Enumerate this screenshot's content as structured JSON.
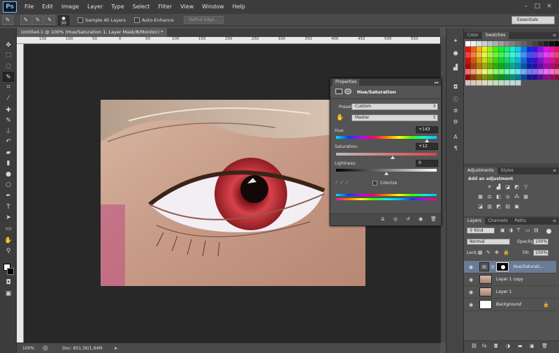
{
  "menubar": {
    "logo": "Ps",
    "items": [
      "File",
      "Edit",
      "Image",
      "Layer",
      "Type",
      "Select",
      "Filter",
      "View",
      "Window",
      "Help"
    ],
    "controls": [
      "–",
      "□",
      "×"
    ]
  },
  "options": {
    "brush_size": "30",
    "sample_all_layers": "Sample All Layers",
    "auto_enhance": "Auto-Enhance",
    "refine_edge": "Refine Edge...",
    "workspace": "Essentials"
  },
  "document": {
    "tab_title": "Untitled-1 @ 100% (Hue/Saturation 1, Layer Mask/8/Monitor) *",
    "zoom": "100%",
    "doc_info": "Doc: 851,3K/1,94M"
  },
  "ruler": {
    "top_ticks": [
      "150",
      "100",
      "50",
      "0",
      "50",
      "100",
      "150",
      "200",
      "250",
      "300",
      "350",
      "400",
      "450",
      "500",
      "550"
    ]
  },
  "properties": {
    "title": "Properties",
    "adjust_name": "Hue/Saturation",
    "preset_label": "Preset:",
    "preset_value": "Custom",
    "channel_value": "Master",
    "hue_label": "Hue:",
    "hue_value": "+143",
    "hue_level": 0.9,
    "saturation_label": "Saturation:",
    "saturation_value": "+12",
    "saturation_level": 0.56,
    "lightness_label": "Lightness:",
    "lightness_value": "0",
    "lightness_level": 0.5,
    "colorize_label": "Colorize"
  },
  "panels": {
    "color_tab": "Color",
    "swatches_tab": "Swatches",
    "adjustments_tab": "Adjustments",
    "styles_tab": "Styles",
    "add_adjustment": "Add an adjustment",
    "layers_tab": "Layers",
    "channels_tab": "Channels",
    "paths_tab": "Paths"
  },
  "layers_panel": {
    "kind": "Kind",
    "blend_mode": "Normal",
    "opacity_label": "Opacity:",
    "opacity_value": "100%",
    "lock_label": "Lock:",
    "fill_label": "Fill:",
    "fill_value": "100%",
    "layers": [
      {
        "name": "Hue/Saturati...",
        "selected": true
      },
      {
        "name": "Layer 1 copy",
        "selected": false
      },
      {
        "name": "Layer 1",
        "selected": false
      },
      {
        "name": "Background",
        "selected": false
      }
    ]
  },
  "colors": {
    "accent": "#6b7b96",
    "iris": "#c8323a"
  }
}
